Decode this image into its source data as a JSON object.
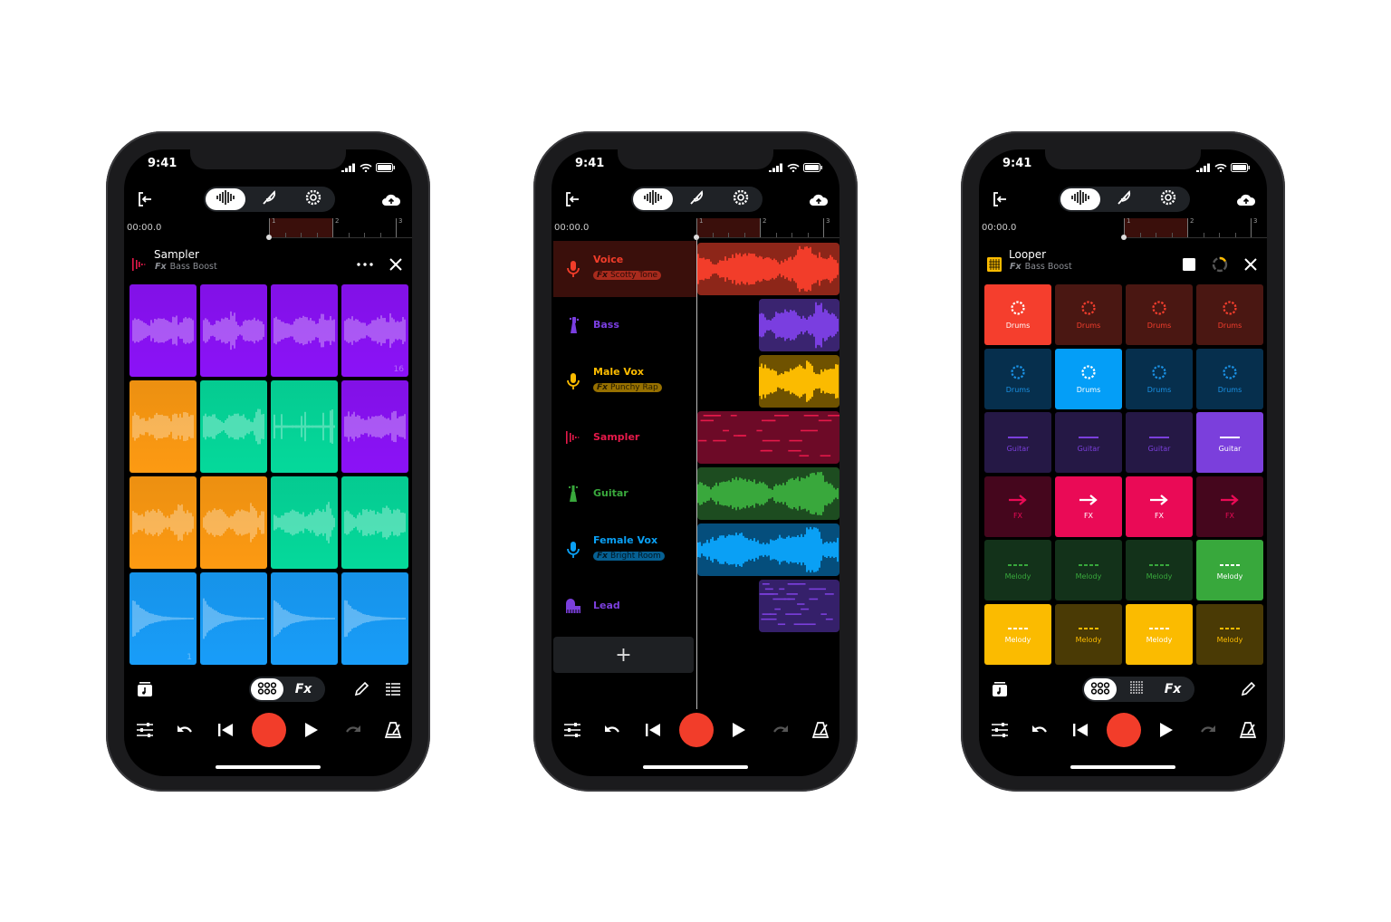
{
  "status_time": "9:41",
  "timeline": {
    "time": "00:00.0",
    "bars": [
      "1",
      "2",
      "3"
    ]
  },
  "colors": {
    "record": "#f23d2a",
    "background": "#000000",
    "pill": "#1f2226"
  },
  "top_toolbar": {
    "icons": [
      "exit-icon",
      "waveform-icon",
      "quill-icon",
      "gear-icon",
      "cloud-upload-icon"
    ],
    "active": "waveform"
  },
  "transport": {
    "icons": [
      "mixer-sliders-icon",
      "undo-icon",
      "skip-back-icon",
      "record-button",
      "play-icon",
      "redo-icon",
      "metronome-icon"
    ]
  },
  "phones": [
    {
      "view": "sampler",
      "header": {
        "title": "Sampler",
        "fx_label": "Fx",
        "fx": "Bass Boost",
        "icon": "sampler-icon",
        "color": "#e5194a"
      },
      "pads": [
        {
          "color": "#8b12f7"
        },
        {
          "color": "#8b12f7"
        },
        {
          "color": "#8b12f7"
        },
        {
          "color": "#8b12f7",
          "label": "16"
        },
        {
          "color": "#fd9a12"
        },
        {
          "color": "#05d99b"
        },
        {
          "color": "#05d99b"
        },
        {
          "color": "#8b12f7"
        },
        {
          "color": "#fd9a12"
        },
        {
          "color": "#fd9a12"
        },
        {
          "color": "#05d99b"
        },
        {
          "color": "#05d99b"
        },
        {
          "color": "#189df9",
          "label": "1"
        },
        {
          "color": "#189df9"
        },
        {
          "color": "#189df9"
        },
        {
          "color": "#189df9"
        }
      ],
      "bottom": {
        "segments": [
          "pads-icon",
          "Fx"
        ],
        "right_icons": [
          "pencil-icon",
          "list-icon"
        ]
      }
    },
    {
      "view": "tracks",
      "tracks": [
        {
          "name": "Voice",
          "icon": "mic-icon",
          "color": "#f23d2a",
          "fx_label": "Fx",
          "fx": "Scotty Tone",
          "clip_bg": "#8d2619",
          "clip_type": "wave",
          "selected": true
        },
        {
          "name": "Bass",
          "icon": "bass-guitar-icon",
          "color": "#7a3ee0",
          "clip_bg": "#3a2470",
          "clip_type": "wave",
          "late": true
        },
        {
          "name": "Male Vox",
          "icon": "mic-icon",
          "color": "#fbbb00",
          "fx_label": "Fx",
          "fx": "Punchy Rap",
          "clip_bg": "#6f5200",
          "clip_type": "wave",
          "late": true
        },
        {
          "name": "Sampler",
          "icon": "sampler-icon",
          "color": "#e5194a",
          "clip_bg": "#6d0a27",
          "clip_type": "notes"
        },
        {
          "name": "Guitar",
          "icon": "guitar-icon",
          "color": "#39a83c",
          "clip_bg": "#1d4c20",
          "clip_type": "wave"
        },
        {
          "name": "Female Vox",
          "icon": "mic-icon",
          "color": "#0aa0f5",
          "fx_label": "Fx",
          "fx": "Bright Room",
          "clip_bg": "#054e7c",
          "clip_type": "wave"
        },
        {
          "name": "Lead",
          "icon": "piano-icon",
          "color": "#7b3fdc",
          "clip_bg": "#35206a",
          "clip_type": "notes",
          "late": true
        }
      ],
      "add_label": "+"
    },
    {
      "view": "looper",
      "header": {
        "title": "Looper",
        "fx_label": "Fx",
        "fx": "Bass Boost",
        "icon": "grid-icon",
        "color": "#fbbb00"
      },
      "rows": [
        {
          "label": "Drums",
          "icon": "dotted-circle-icon",
          "on": "#f53e2d",
          "off": "#4a1712",
          "accent": "#f53e2d",
          "active": [
            0
          ]
        },
        {
          "label": "Drums",
          "icon": "dotted-circle-icon",
          "on": "#049ef7",
          "off": "#062f4d",
          "accent": "#1a92e6",
          "active": [
            1
          ]
        },
        {
          "label": "Guitar",
          "icon": "line-icon",
          "on": "#7b3fdc",
          "off": "#251845",
          "accent": "#7b3fdc",
          "active": [
            3
          ]
        },
        {
          "label": "FX",
          "icon": "arrow-right-icon",
          "on": "#ea0a56",
          "off": "#45061d",
          "accent": "#ea0a56",
          "active": [
            1,
            2
          ]
        },
        {
          "label": "Melody",
          "icon": "dashes-icon",
          "on": "#38a83c",
          "off": "#13321a",
          "accent": "#38a83c",
          "active": [
            3
          ]
        },
        {
          "label": "Melody",
          "icon": "dashes-icon",
          "on": "#fbbb00",
          "off": "#4a3a05",
          "accent": "#fbbb00",
          "active": [
            0,
            2
          ]
        }
      ],
      "bottom": {
        "segments": [
          "pads-icon",
          "dot-grid-icon",
          "Fx"
        ],
        "right_icons": [
          "pencil-icon"
        ]
      }
    }
  ]
}
